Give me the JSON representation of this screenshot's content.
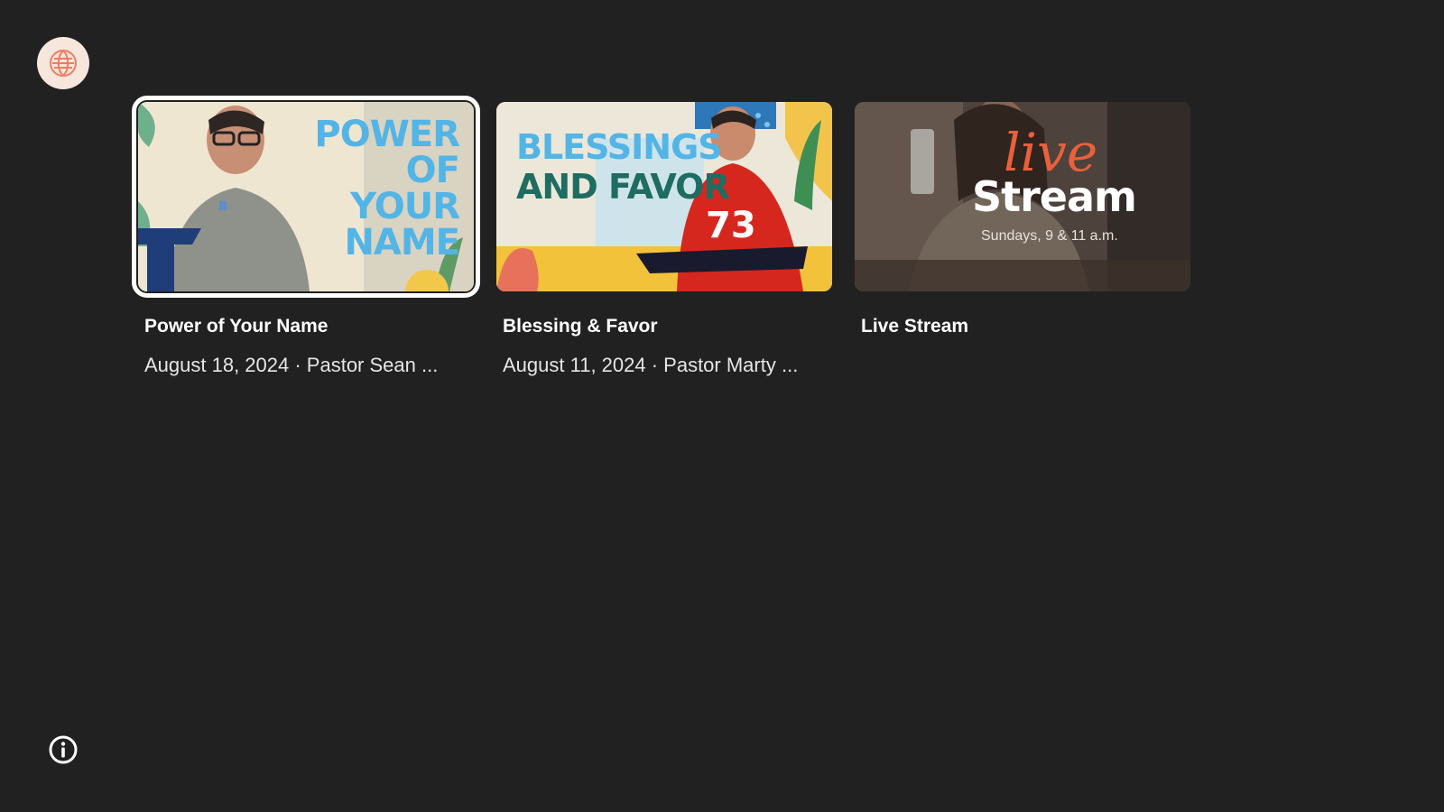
{
  "app": {
    "logo_icon": "church-logo-icon",
    "info_icon": "info-icon"
  },
  "cards": [
    {
      "title": "Power of Your Name",
      "subtitle": "August 18, 2024 · Pastor Sean ...",
      "thumbnail_text": "POWER OF YOUR NAME",
      "focused": true
    },
    {
      "title": "Blessing & Favor",
      "subtitle": "August 11, 2024 · Pastor Marty ...",
      "thumbnail_text": "BLESSINGS AND FAVOR",
      "thumbnail_jersey": "73",
      "focused": false
    },
    {
      "title": "Live Stream",
      "subtitle": "",
      "thumbnail_script": "live",
      "thumbnail_big": "Stream",
      "thumbnail_small": "Sundays, 9 & 11 a.m.",
      "focused": false
    }
  ],
  "colors": {
    "background": "#212121",
    "focus_ring": "#ffffff",
    "accent_blue": "#53b4e6",
    "accent_orange": "#e8603c"
  }
}
